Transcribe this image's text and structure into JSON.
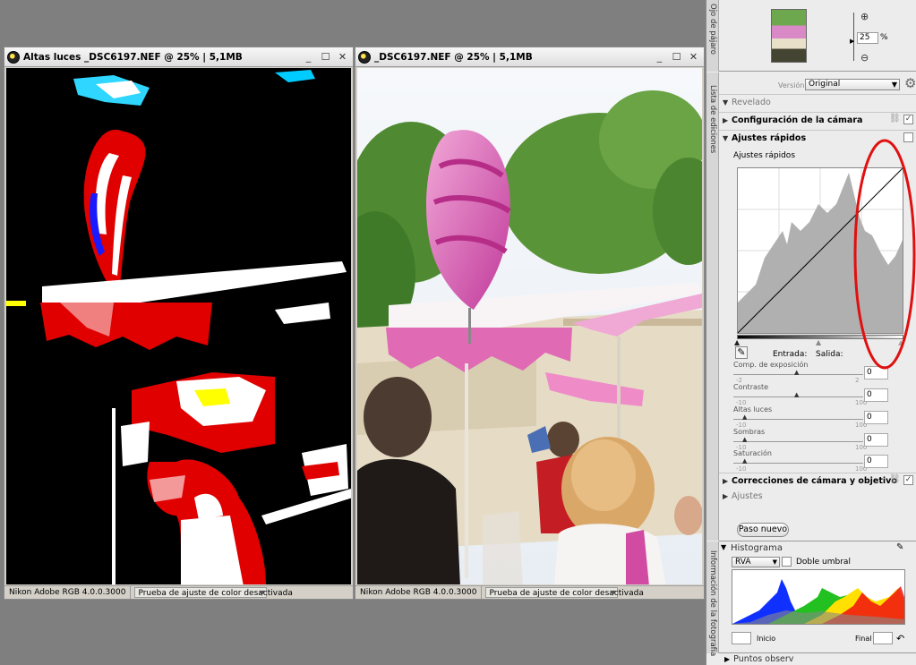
{
  "windows": {
    "left": {
      "title": "Altas luces _DSC6197.NEF @ 25% | 5,1MB",
      "profile": "Nikon Adobe RGB 4.0.0.3000",
      "proof": "Prueba de ajuste de color desactivada"
    },
    "right": {
      "title": "_DSC6197.NEF @ 25% | 5,1MB",
      "profile": "Nikon Adobe RGB 4.0.0.3000",
      "proof": "Prueba de ajuste de color desactivada"
    },
    "controls": {
      "minimize": "_",
      "maximize": "☐",
      "close": "✕"
    }
  },
  "panel": {
    "birdseye": {
      "tab_label": "Ojo de pájaro",
      "zoom_value": "25",
      "zoom_unit": "%"
    },
    "editlist": {
      "tab_label": "Lista de ediciones",
      "version_label": "Versión",
      "version_value": "Original",
      "revelado": "Revelado",
      "camera_config": "Configuración de la cámara",
      "quick_adjust": "Ajustes rápidos",
      "quick_adjust_sub": "Ajustes rápidos",
      "entrada": "Entrada:",
      "salida": "Salida:",
      "sliders": [
        {
          "label": "Comp. de exposición",
          "min": "-2",
          "max": "2",
          "value": "0"
        },
        {
          "label": "Contraste",
          "min": "-10",
          "max": "100",
          "value": "0"
        },
        {
          "label": "Altas luces",
          "min": "-10",
          "max": "100",
          "value": "0"
        },
        {
          "label": "Sombras",
          "min": "-10",
          "max": "100",
          "value": "0"
        },
        {
          "label": "Saturación",
          "min": "-10",
          "max": "100",
          "value": "0"
        }
      ],
      "corrections": "Correcciones de cámara y objetivo",
      "ajustes": "Ajustes",
      "paso_nuevo": "Paso nuevo"
    },
    "histogram": {
      "tab_label": "Información de la fotografía",
      "title": "Histograma",
      "channel": "RVA",
      "double_threshold": "Doble umbral",
      "inicio": "Inicio",
      "final": "Final"
    },
    "puntos": "Puntos observ"
  },
  "colors": {
    "highlight_circle": "#e01010",
    "panel_bg": "#ececec",
    "desktop": "#7f7f7f"
  }
}
